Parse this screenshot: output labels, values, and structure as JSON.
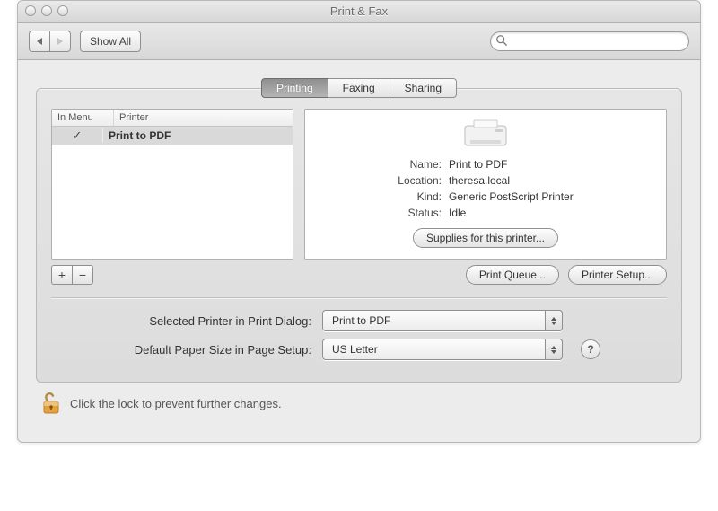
{
  "window": {
    "title": "Print & Fax"
  },
  "toolbar": {
    "show_all_label": "Show All",
    "search_placeholder": ""
  },
  "tabs": {
    "printing": "Printing",
    "faxing": "Faxing",
    "sharing": "Sharing",
    "active": "printing"
  },
  "printer_list": {
    "col_menu": "In Menu",
    "col_printer": "Printer",
    "rows": [
      {
        "in_menu": "✓",
        "name": "Print to PDF"
      }
    ]
  },
  "buttons": {
    "add": "+",
    "remove": "−",
    "print_queue": "Print Queue...",
    "printer_setup": "Printer Setup...",
    "supplies": "Supplies for this printer...",
    "help": "?"
  },
  "detail": {
    "labels": {
      "name": "Name:",
      "location": "Location:",
      "kind": "Kind:",
      "status": "Status:"
    },
    "name": "Print to PDF",
    "location": "theresa.local",
    "kind": "Generic PostScript Printer",
    "status": "Idle"
  },
  "form": {
    "selected_printer_label": "Selected Printer in Print Dialog:",
    "selected_printer_value": "Print to PDF",
    "default_paper_label": "Default Paper Size in Page Setup:",
    "default_paper_value": "US Letter"
  },
  "lock": {
    "text": "Click the lock to prevent further changes."
  }
}
